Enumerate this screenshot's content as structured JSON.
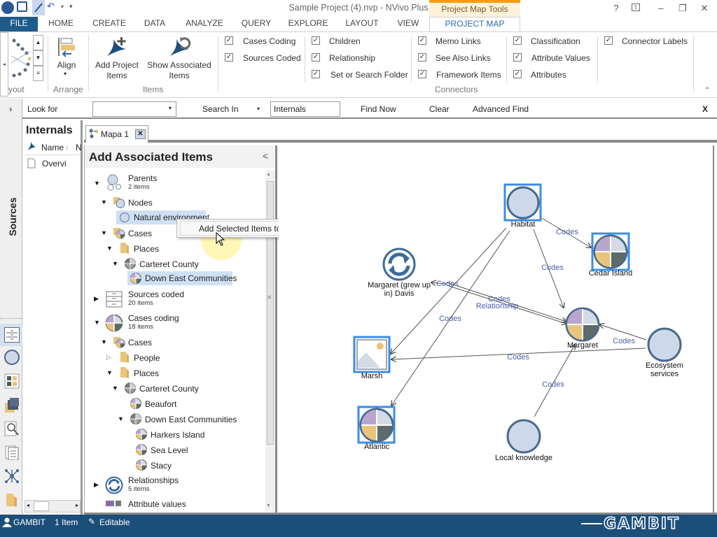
{
  "window": {
    "title": "Sample Project (4).nvp - NVivo Plus",
    "context_tab_group": "Project Map Tools",
    "controls": {
      "help": "?",
      "ribbon_display": "⇧",
      "minimize": "–",
      "restore": "❐",
      "close": "✕"
    }
  },
  "quick_access": {
    "icons": [
      "nvivo-logo-icon",
      "save-icon",
      "edit-icon",
      "undo-icon",
      "dropdown-icon",
      "customize-icon"
    ]
  },
  "ribbon": {
    "tabs": [
      "FILE",
      "HOME",
      "CREATE",
      "DATA",
      "ANALYZE",
      "QUERY",
      "EXPLORE",
      "LAYOUT",
      "VIEW",
      "PROJECT MAP"
    ],
    "active_tab": "PROJECT MAP",
    "groups": {
      "layout": {
        "label": "yout"
      },
      "arrange": {
        "label": "Arrange",
        "align": "Align"
      },
      "items": {
        "label": "Items",
        "add_project_items": [
          "Add Project",
          "Items"
        ],
        "show_associated_items": [
          "Show Associated",
          "Items"
        ]
      },
      "connectors": {
        "label": "Connectors",
        "col1": [
          {
            "label": "Cases Coding",
            "checked": true
          },
          {
            "label": "Sources Coded",
            "checked": true
          }
        ],
        "col2": [
          {
            "label": "Children",
            "checked": true
          },
          {
            "label": "Relationship",
            "checked": true
          },
          {
            "label": "Set or Search Folder",
            "checked": true
          }
        ],
        "col3": [
          {
            "label": "Memo Links",
            "checked": true
          },
          {
            "label": "See Also Links",
            "checked": true
          },
          {
            "label": "Framework Items",
            "checked": true
          }
        ],
        "col4": [
          {
            "label": "Classification",
            "checked": true
          },
          {
            "label": "Attribute Values",
            "checked": true
          },
          {
            "label": "Attributes",
            "checked": true
          }
        ],
        "col5": [
          {
            "label": "Connector Labels",
            "checked": true
          }
        ]
      }
    }
  },
  "findbar": {
    "look_for_label": "Look for",
    "look_for_value": "",
    "search_in_label": "Search In",
    "search_in_value": "Internals",
    "find_now": "Find Now",
    "clear": "Clear",
    "advanced_find": "Advanced Find",
    "close": "X"
  },
  "navigation": {
    "sources_label": "Sources"
  },
  "internals": {
    "title": "Internals",
    "column_name": "Name",
    "sort_indicator": "/",
    "column_next": "N",
    "rows": [
      "Overvi"
    ]
  },
  "document_tab": {
    "label": "Mapa 1"
  },
  "add_associated_items": {
    "title": "Add Associated Items",
    "collapse": "<",
    "tree": {
      "parents": {
        "label": "Parents",
        "count": "2 items"
      },
      "nodes": "Nodes",
      "natural_environment": "Natural environment",
      "cases1": "Cases",
      "places1": "Places",
      "carteret1": "Carteret County",
      "down_east1": "Down East Communities",
      "sources_coded": {
        "label": "Sources coded",
        "count": "20 items"
      },
      "cases_coding": {
        "label": "Cases coding",
        "count": "18 items"
      },
      "cases2": "Cases",
      "people": "People",
      "places2": "Places",
      "carteret2": "Carteret County",
      "beaufort": "Beaufort",
      "down_east2": "Down East Communities",
      "harkers_island": "Harkers Island",
      "sea_level": "Sea Level",
      "stacy": "Stacy",
      "relationships": {
        "label": "Relationships",
        "count": "5 items"
      },
      "attribute_values": "Attribute values"
    }
  },
  "context_menu": {
    "item": "Add Selected Items to Map"
  },
  "project_map": {
    "nodes": {
      "habitat": {
        "label": "Habitat",
        "type": "node",
        "selected": true
      },
      "cedar_island": {
        "label": "Cedar Island",
        "type": "case",
        "selected": true
      },
      "margaret_davis": {
        "label_line1": "Margaret (grew up",
        "label_line2": "in) Davis",
        "type": "relationship",
        "selected": false
      },
      "margaret": {
        "label": "Margaret",
        "type": "case",
        "selected": false
      },
      "marsh": {
        "label": "Marsh",
        "type": "picture",
        "selected": true
      },
      "ecosystem_services": {
        "label_line1": "Ecosystem",
        "label_line2": "services",
        "type": "node",
        "selected": false
      },
      "atlantic": {
        "label": "Atlantic",
        "type": "case",
        "selected": true
      },
      "local_knowledge": {
        "label": "Local knowledge",
        "type": "node",
        "selected": false
      }
    },
    "connector_labels": {
      "habitat_cedar": "Codes",
      "habitat_margaret": "Codes",
      "to_margaret_davis": "Codes",
      "margaret_codes": "Codes",
      "relationship": "Relationship",
      "habitat_atlantic": "Codes",
      "eco_marsh": "Codes",
      "eco_margaret": "Codes",
      "local_margaret": "Codes"
    },
    "colors": {
      "selection": "#3a8ee6",
      "node_fill": "#cdd9e8",
      "node_stroke": "#4a6a8c",
      "connector_label": "#4a5fa8",
      "case_purple": "#b9a6cf",
      "case_light": "#d3dbe6",
      "case_yellow": "#e9c47a",
      "case_dark": "#5c6b6b"
    }
  },
  "statusbar": {
    "user": "GAMBIT",
    "items": "1 Item",
    "mode": "Editable",
    "brand": "GAMBIT"
  }
}
